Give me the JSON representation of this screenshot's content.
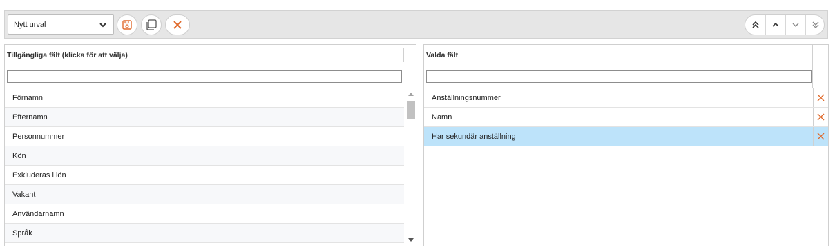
{
  "toolbar": {
    "selection_value": "Nytt urval",
    "icons": {
      "save": "save-icon",
      "copy": "copy-icon",
      "clear": "close-icon"
    },
    "nav_icons": [
      "double-chevron-up-icon",
      "chevron-up-icon",
      "chevron-down-icon",
      "double-chevron-down-icon"
    ],
    "colors": {
      "accent": "#e06a2c"
    }
  },
  "available": {
    "title": "Tillgängliga fält (klicka för att välja)",
    "filter_value": "",
    "items": [
      "Förnamn",
      "Efternamn",
      "Personnummer",
      "Kön",
      "Exkluderas i lön",
      "Vakant",
      "Användarnamn",
      "Språk"
    ]
  },
  "selected": {
    "title": "Valda fält",
    "filter_value": "",
    "items": [
      {
        "label": "Anställningsnummer",
        "highlighted": false
      },
      {
        "label": "Namn",
        "highlighted": false
      },
      {
        "label": "Har sekundär anställning",
        "highlighted": true
      }
    ],
    "remove_icon": "close-icon",
    "highlight_color": "#bde3fa"
  }
}
